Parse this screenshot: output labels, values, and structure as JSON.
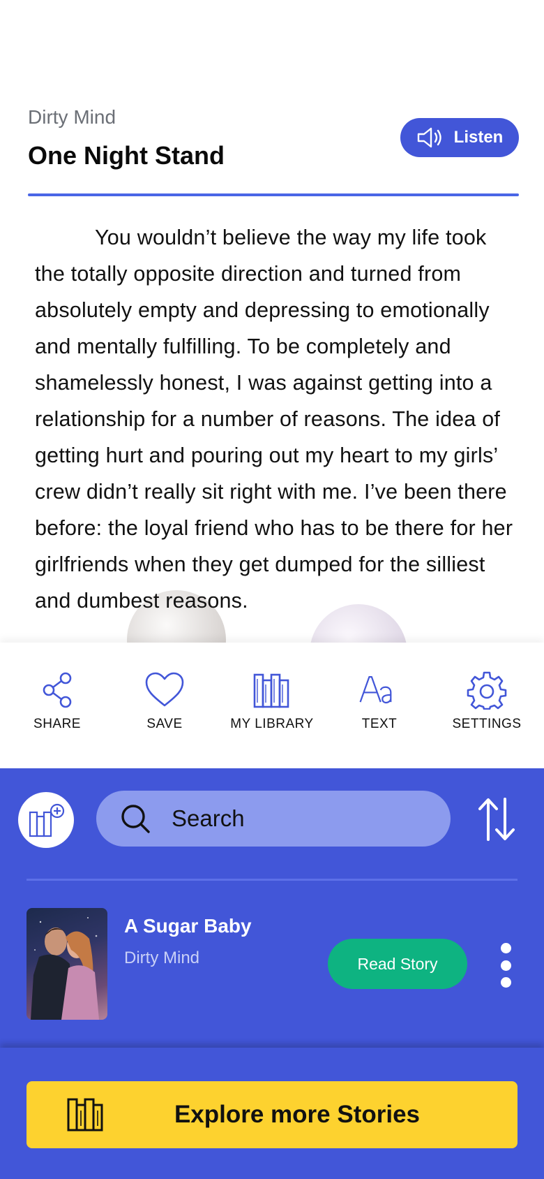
{
  "story": {
    "category": "Dirty Mind",
    "title": "One Night Stand",
    "listen_label": "Listen",
    "text": "You wouldn’t believe the way my life took the totally opposite direction and turned from absolutely empty and depressing to emotionally and mentally fulfilling. To be completely and shamelessly honest, I was against getting into a relationship for a number of reasons. The idea of getting hurt and pouring out my heart to my girls’ crew didn’t really sit right with me. I’ve been there before: the loyal friend who has to be there for her girlfriends when they get dumped for the silliest and dumbest reasons."
  },
  "actions": [
    {
      "label": "SHARE",
      "icon": "share-icon"
    },
    {
      "label": "SAVE",
      "icon": "heart-icon"
    },
    {
      "label": "MY LIBRARY",
      "icon": "library-icon"
    },
    {
      "label": "TEXT",
      "icon": "text-size-icon"
    },
    {
      "label": "SETTINGS",
      "icon": "gear-icon"
    }
  ],
  "library": {
    "search_placeholder": "Search",
    "items": [
      {
        "title": "A Sugar Baby",
        "category": "Dirty Mind",
        "read_label": "Read Story"
      }
    ]
  },
  "footer": {
    "explore_label": "Explore more Stories"
  },
  "colors": {
    "primary": "#4256d8",
    "read_button": "#0eb381",
    "explore_button": "#fdd22f"
  }
}
